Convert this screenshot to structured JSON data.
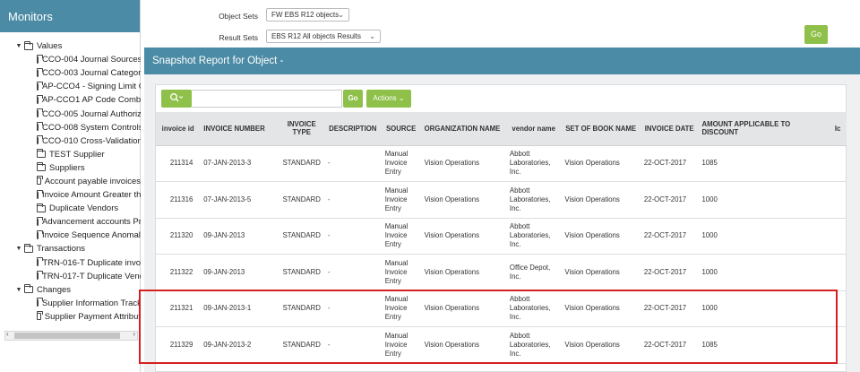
{
  "left_panel": {
    "title": "Monitors",
    "tree": [
      {
        "label": "Values",
        "level": 0,
        "expanded": true
      },
      {
        "label": "CCO-004 Journal Sources",
        "level": 1
      },
      {
        "label": "CCO-003 Journal Categori",
        "level": 1
      },
      {
        "label": "AP-CCO4 - Signing Limit C",
        "level": 1
      },
      {
        "label": "AP-CCO1 AP Code Combi",
        "level": 1
      },
      {
        "label": "CCO-005 Journal Authoriz",
        "level": 1
      },
      {
        "label": "CCO-008 System Controls",
        "level": 1
      },
      {
        "label": "CCO-010 Cross-Validation",
        "level": 1
      },
      {
        "label": "TEST Supplier",
        "level": 1
      },
      {
        "label": "Suppliers",
        "level": 1
      },
      {
        "label": "Account payable invoices",
        "level": 1
      },
      {
        "label": "Invoice Amount Greater th",
        "level": 1
      },
      {
        "label": "Duplicate Vendors",
        "level": 1
      },
      {
        "label": "Advancement accounts Pr",
        "level": 1
      },
      {
        "label": "Invoice Sequence Anomali",
        "level": 1
      },
      {
        "label": "Transactions",
        "level": 0,
        "expanded": true
      },
      {
        "label": "TRN-016-T Duplicate invo",
        "level": 1
      },
      {
        "label": "TRN-017-T Duplicate Venc",
        "level": 1
      },
      {
        "label": "Changes",
        "level": 0,
        "expanded": true
      },
      {
        "label": "Supplier Information Track",
        "level": 1
      },
      {
        "label": "Supplier Payment Attribut",
        "level": 1
      }
    ]
  },
  "form": {
    "object_sets_label": "Object Sets",
    "object_sets_value": "FW EBS R12 objects",
    "result_sets_label": "Result Sets",
    "result_sets_value": "EBS R12 All objects Results",
    "go_label": "Go"
  },
  "report": {
    "title": "Snapshot Report for Object -",
    "search_icon": "search-icon",
    "go_label": "Go",
    "actions_label": "Actions"
  },
  "table": {
    "columns": [
      "invoice id",
      "INVOICE NUMBER",
      "INVOICE TYPE",
      "DESCRIPTION",
      "SOURCE",
      "ORGANIZATION NAME",
      "vendor name",
      "SET OF BOOK NAME",
      "INVOICE DATE",
      "AMOUNT APPLICABLE TO DISCOUNT",
      "Ic"
    ],
    "rows": [
      [
        "211314",
        "07-JAN-2013-3",
        "STANDARD",
        "-",
        "Manual Invoice Entry",
        "Vision Operations",
        "Abbott Laboratories, Inc.",
        "Vision Operations",
        "22-OCT-2017",
        "1085",
        ""
      ],
      [
        "211316",
        "07-JAN-2013-5",
        "STANDARD",
        "-",
        "Manual Invoice Entry",
        "Vision Operations",
        "Abbott Laboratories, Inc.",
        "Vision Operations",
        "22-OCT-2017",
        "1000",
        ""
      ],
      [
        "211320",
        "09-JAN-2013",
        "STANDARD",
        "-",
        "Manual Invoice Entry",
        "Vision Operations",
        "Abbott Laboratories, Inc.",
        "Vision Operations",
        "22-OCT-2017",
        "1000",
        ""
      ],
      [
        "211322",
        "09-JAN-2013",
        "STANDARD",
        "-",
        "Manual Invoice Entry",
        "Vision Operations",
        "Office Depot, Inc.",
        "Vision Operations",
        "22-OCT-2017",
        "1000",
        ""
      ],
      [
        "211321",
        "09-JAN-2013-1",
        "STANDARD",
        "-",
        "Manual Invoice Entry",
        "Vision Operations",
        "Abbott Laboratories, Inc.",
        "Vision Operations",
        "22-OCT-2017",
        "1000",
        ""
      ],
      [
        "211329",
        "09-JAN-2013-2",
        "STANDARD",
        "-",
        "Manual Invoice Entry",
        "Vision Operations",
        "Abbott Laboratories, Inc.",
        "Vision Operations",
        "22-OCT-2017",
        "1085",
        ""
      ]
    ]
  },
  "colors": {
    "header_blue": "#4b8ba5",
    "button_green": "#8ec04a",
    "highlight_red": "#d62020"
  }
}
